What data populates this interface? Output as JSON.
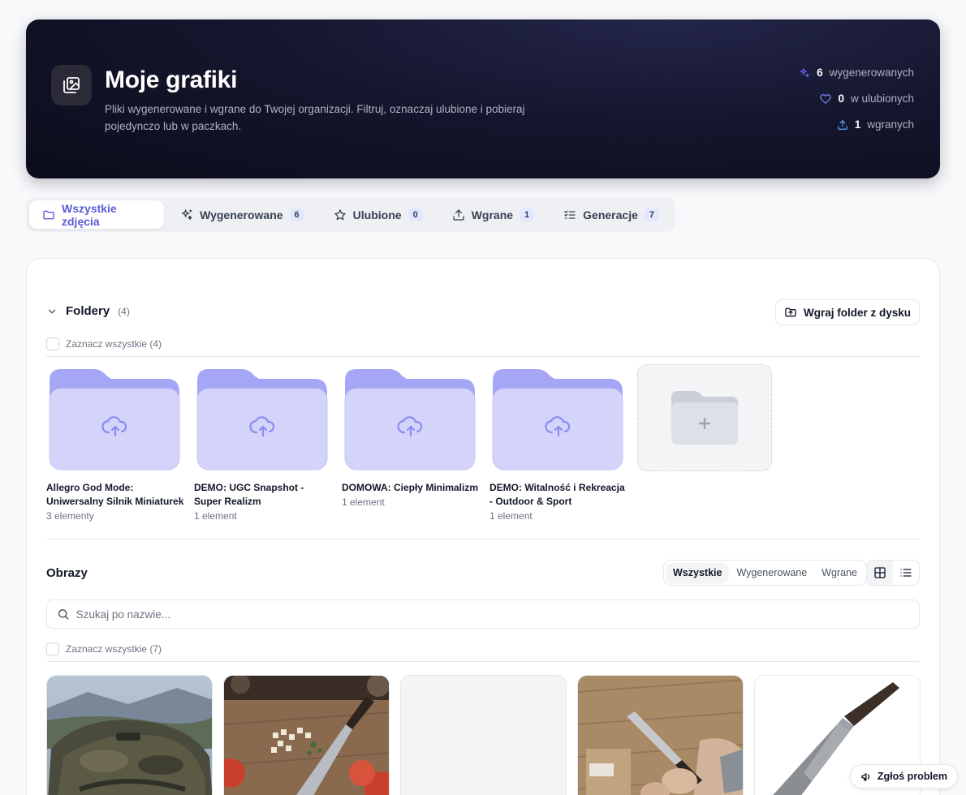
{
  "hero": {
    "title": "Moje grafiki",
    "description": "Pliki wygenerowane i wgrane do Twojej organizacji. Filtruj, oznaczaj ulubione i pobieraj pojedynczo lub w paczkach.",
    "icon": "image-gallery-icon",
    "stats": [
      {
        "icon": "sparkles-icon",
        "value": "6",
        "label": "wygenerowanych",
        "color": "#6366f1"
      },
      {
        "icon": "heart-icon",
        "value": "0",
        "label": "w ulubionych",
        "color": "#818cf8"
      },
      {
        "icon": "upload-icon",
        "value": "1",
        "label": "wgranych",
        "color": "#60a5fa"
      }
    ]
  },
  "tabs": [
    {
      "label": "Wszystkie zdjęcia",
      "icon": "folder-icon",
      "badge": null,
      "active": true
    },
    {
      "label": "Wygenerowane",
      "icon": "sparkles-icon",
      "badge": "6"
    },
    {
      "label": "Ulubione",
      "icon": "star-icon",
      "badge": "0"
    },
    {
      "label": "Wgrane",
      "icon": "upload-icon",
      "badge": "1"
    },
    {
      "label": "Generacje",
      "icon": "list-checks-icon",
      "badge": "7"
    }
  ],
  "folders_section": {
    "title": "Foldery",
    "count": "(4)",
    "upload_button": "Wgraj folder z dysku",
    "select_all": "Zaznacz wszystkie (4)",
    "folders": [
      {
        "name": "Allegro God Mode: Uniwersalny Silnik Miniaturek",
        "count": "3 elementy"
      },
      {
        "name": "DEMO: UGC Snapshot - Super Realizm",
        "count": "1 element"
      },
      {
        "name": "DOMOWA: Ciepły Minimalizm",
        "count": "1 element"
      },
      {
        "name": "DEMO: Witalność i Rekreacja - Outdoor & Sport",
        "count": "1 element"
      }
    ]
  },
  "images_section": {
    "title": "Obrazy",
    "filters": [
      "Wszystkie",
      "Wygenerowane",
      "Wgrane"
    ],
    "active_filter": "Wszystkie",
    "search_placeholder": "Szukaj po nazwie...",
    "select_all": "Zaznacz wszystkie (7)"
  },
  "report_button": "Zgłoś problem",
  "colors": {
    "accent": "#5b5bd6",
    "folder": "#d4d4fb",
    "folder_tab": "#a5a6f6"
  }
}
